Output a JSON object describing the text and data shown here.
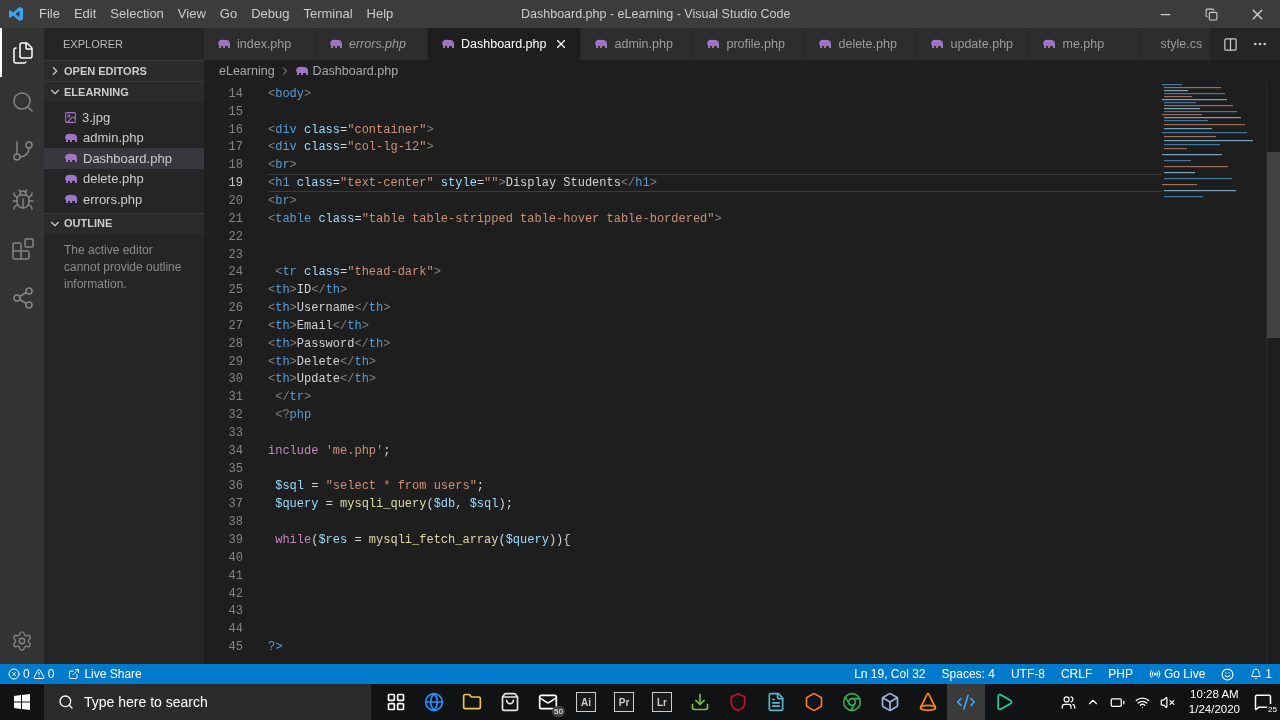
{
  "title_bar": {
    "menu": [
      "File",
      "Edit",
      "Selection",
      "View",
      "Go",
      "Debug",
      "Terminal",
      "Help"
    ],
    "title": "Dashboard.php - eLearning - Visual Studio Code"
  },
  "activity_bar": [
    {
      "kind": "files",
      "selected": true
    },
    {
      "kind": "search",
      "selected": false
    },
    {
      "kind": "git",
      "selected": false
    },
    {
      "kind": "debug",
      "selected": false
    },
    {
      "kind": "extensions",
      "selected": false
    },
    {
      "kind": "remote",
      "selected": false
    }
  ],
  "sidebar": {
    "header": "EXPLORER",
    "sections": [
      {
        "label": "OPEN EDITORS",
        "expanded": false
      },
      {
        "label": "ELEARNING",
        "expanded": true,
        "files": [
          {
            "name": "3.jpg",
            "kind": "image",
            "selected": false
          },
          {
            "name": "admin.php",
            "kind": "php",
            "selected": false
          },
          {
            "name": "Dashboard.php",
            "kind": "php",
            "selected": true
          },
          {
            "name": "delete.php",
            "kind": "php",
            "selected": false
          },
          {
            "name": "errors.php",
            "kind": "php",
            "selected": false
          }
        ]
      },
      {
        "label": "OUTLINE",
        "expanded": true,
        "message": "The active editor cannot provide outline information."
      }
    ]
  },
  "tabs": [
    {
      "label": "index.php",
      "kind": "php",
      "selected": false,
      "preview": false
    },
    {
      "label": "errors.php",
      "kind": "php",
      "selected": false,
      "preview": true
    },
    {
      "label": "Dashboard.php",
      "kind": "php",
      "selected": true,
      "preview": false
    },
    {
      "label": "admin.php",
      "kind": "php",
      "selected": false,
      "preview": false
    },
    {
      "label": "profile.php",
      "kind": "php",
      "selected": false,
      "preview": false
    },
    {
      "label": "delete.php",
      "kind": "php",
      "selected": false,
      "preview": false
    },
    {
      "label": "update.php",
      "kind": "php",
      "selected": false,
      "preview": false
    },
    {
      "label": "me.php",
      "kind": "php",
      "selected": false,
      "preview": false
    },
    {
      "label": "style.cs",
      "kind": "css",
      "selected": false,
      "preview": false
    }
  ],
  "breadcrumb": [
    "eLearning",
    "Dashboard.php"
  ],
  "editor": {
    "lines": [
      {
        "number": "14",
        "current": false,
        "code": "<body>"
      },
      {
        "number": "15",
        "current": false
      },
      {
        "number": "16",
        "current": false,
        "code": "<div class=\"container\">"
      },
      {
        "number": "17",
        "current": false,
        "code": "<div class=\"col-lg-12\">"
      },
      {
        "number": "18",
        "current": false,
        "code": "<br>"
      },
      {
        "number": "19",
        "current": true,
        "code": "<h1 class=\"text-center\" style=\"\">Display Students</h1>"
      },
      {
        "number": "20",
        "current": false,
        "code": "<br>"
      },
      {
        "number": "21",
        "current": false,
        "code": "<table class=\"table table-stripped table-hover table-bordered\">"
      },
      {
        "number": "22",
        "current": false
      },
      {
        "number": "23",
        "current": false
      },
      {
        "number": "24",
        "current": false,
        "code": " <tr class=\"thead-dark\">"
      },
      {
        "number": "25",
        "current": false,
        "code": "<th>ID</th>"
      },
      {
        "number": "26",
        "current": false,
        "code": "<th>Username</th>"
      },
      {
        "number": "27",
        "current": false,
        "code": "<th>Email</th>"
      },
      {
        "number": "28",
        "current": false,
        "code": "<th>Password</th>"
      },
      {
        "number": "29",
        "current": false,
        "code": "<th>Delete</th>"
      },
      {
        "number": "30",
        "current": false,
        "code": "<th>Update</th>"
      },
      {
        "number": "31",
        "current": false,
        "code": " </tr>"
      },
      {
        "number": "32",
        "current": false,
        "code": " <?php"
      },
      {
        "number": "33",
        "current": false
      },
      {
        "number": "34",
        "current": false,
        "code": "include 'me.php';"
      },
      {
        "number": "35",
        "current": false
      },
      {
        "number": "36",
        "current": false,
        "code": " $sql = \"select * from users\";"
      },
      {
        "number": "37",
        "current": false,
        "code": " $query = mysqli_query($db, $sql);"
      },
      {
        "number": "38",
        "current": false
      },
      {
        "number": "39",
        "current": false,
        "code": " while($res = mysqli_fetch_array($query)){"
      },
      {
        "number": "40",
        "current": false
      },
      {
        "number": "41",
        "current": false
      },
      {
        "number": "42",
        "current": false
      },
      {
        "number": "43",
        "current": false
      },
      {
        "number": "44",
        "current": false
      },
      {
        "number": "45",
        "current": false,
        "code": "?>"
      }
    ]
  },
  "status_bar": {
    "errors": "0",
    "warnings": "0",
    "live_share": "Live Share",
    "right": [
      "Ln 19, Col 32",
      "Spaces: 4",
      "UTF-8",
      "CRLF",
      "PHP"
    ],
    "go_live": "Go Live",
    "notifications": "1"
  },
  "taskbar": {
    "search_placeholder": "Type here to search",
    "apps": [
      {
        "kind": "taskview"
      },
      {
        "kind": "edge"
      },
      {
        "kind": "folder"
      },
      {
        "kind": "store"
      },
      {
        "kind": "mail",
        "badge": "50"
      },
      {
        "kind": "label",
        "label": "Ai"
      },
      {
        "kind": "label",
        "label": "Pr"
      },
      {
        "kind": "label",
        "label": "Lr"
      },
      {
        "kind": "torrent"
      },
      {
        "kind": "shield"
      },
      {
        "kind": "notepad"
      },
      {
        "kind": "xampp"
      },
      {
        "kind": "chrome"
      },
      {
        "kind": "box"
      },
      {
        "kind": "vlc"
      },
      {
        "kind": "vscode"
      },
      {
        "kind": "play"
      }
    ],
    "time": "10:28 AM",
    "date": "1/24/2020",
    "notification_count": "25"
  }
}
